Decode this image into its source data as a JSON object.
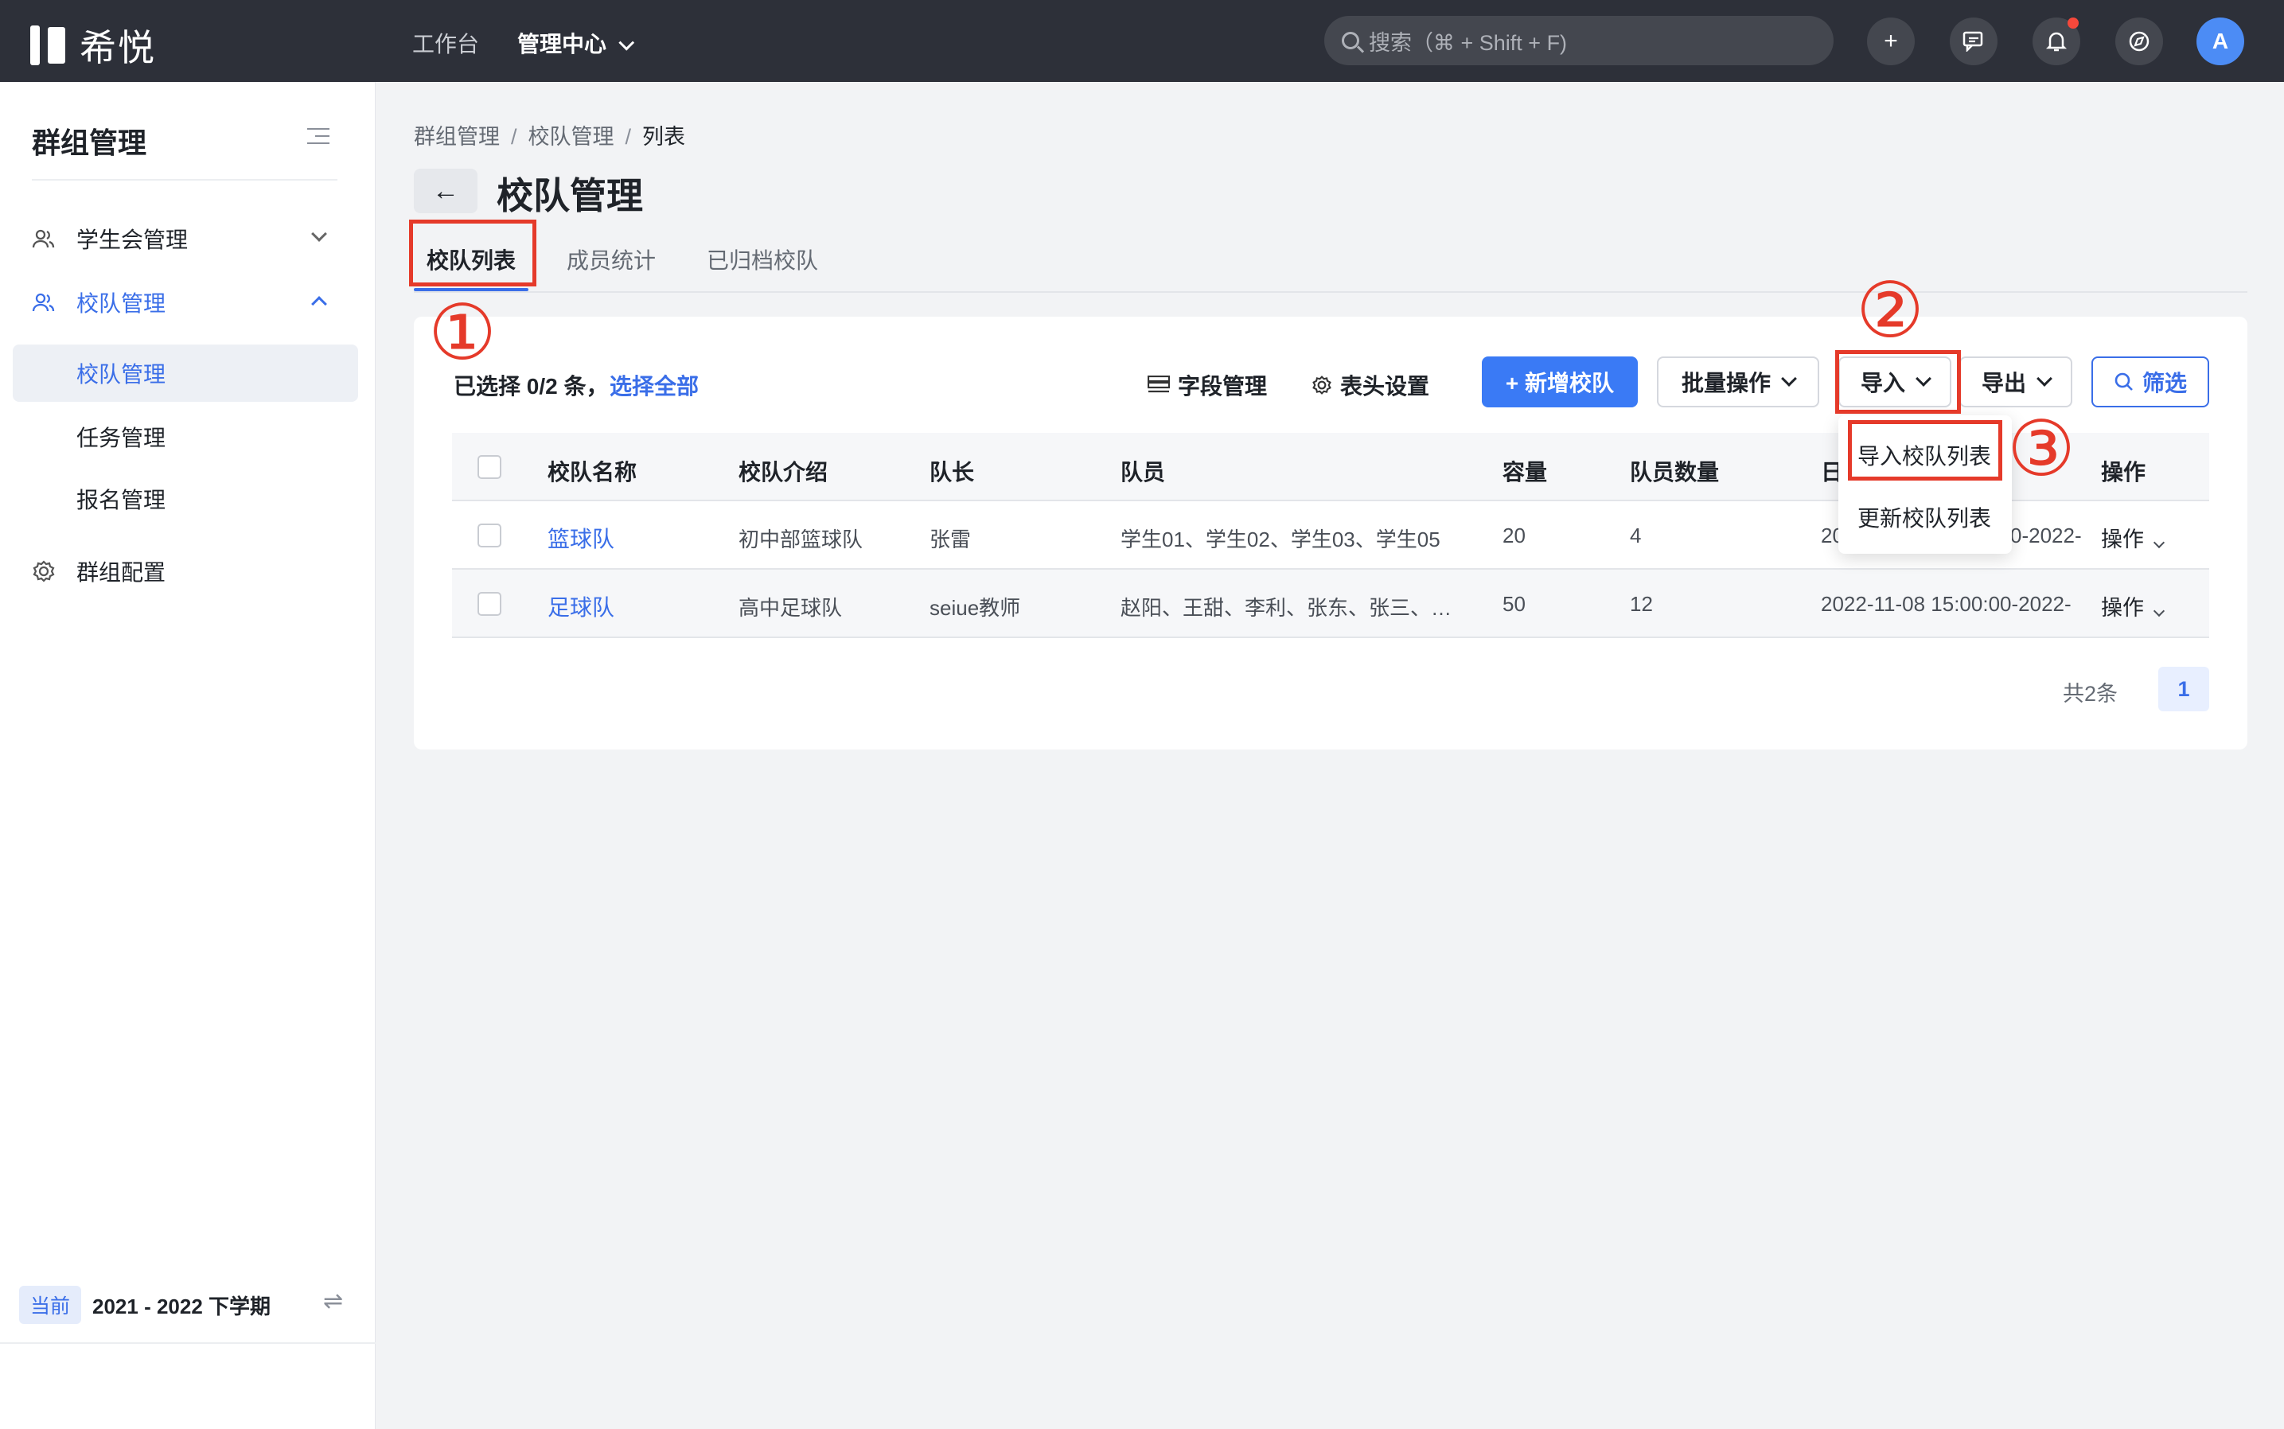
{
  "topbar": {
    "brand": "希悦",
    "nav": [
      "工作台",
      "管理中心"
    ],
    "search_placeholder": "搜索（⌘ + Shift + F)",
    "plus_icon": "+",
    "avatar": "A"
  },
  "sidebar": {
    "title": "群组管理",
    "items": [
      {
        "label": "学生会管理"
      },
      {
        "label": "校队管理"
      },
      {
        "label": "群组配置"
      }
    ],
    "subitems": [
      {
        "label": "校队管理"
      },
      {
        "label": "任务管理"
      },
      {
        "label": "报名管理"
      }
    ],
    "semester_badge": "当前",
    "semester": "2021 - 2022 下学期"
  },
  "breadcrumb": [
    "群组管理",
    "校队管理",
    "列表"
  ],
  "page_title": "校队管理",
  "tabs": [
    "校队列表",
    "成员统计",
    "已归档校队"
  ],
  "toolbar": {
    "selected": "已选择 0/2 条，",
    "select_all": "选择全部",
    "field_mgmt": "字段管理",
    "header_settings": "表头设置",
    "add_team": "+ 新增校队",
    "batch": "批量操作",
    "import": "导入",
    "export": "导出",
    "filter": "筛选"
  },
  "table": {
    "columns": [
      "校队名称",
      "校队介绍",
      "队长",
      "队员",
      "容量",
      "队员数量",
      "日",
      "操作"
    ],
    "rows": [
      {
        "name": "篮球队",
        "intro": "初中部篮球队",
        "captain": "张雷",
        "members": "学生01、学生02、学生03、学生05",
        "capacity": "20",
        "count": "4",
        "date": "20",
        "date_tail": "0-2022-",
        "op": "操作"
      },
      {
        "name": "足球队",
        "intro": "高中足球队",
        "captain": "seiue教师",
        "members": "赵阳、王甜、李利、张东、张三、…",
        "capacity": "50",
        "count": "12",
        "date": "2022-11-08 15:00:00-2022-",
        "op": "操作"
      }
    ]
  },
  "pagination": {
    "total": "共2条",
    "page": "1"
  },
  "dropdown": [
    "导入校队列表",
    "更新校队列表"
  ],
  "annotations": [
    "①",
    "②",
    "③"
  ],
  "colors": {
    "accent": "#3a6ee8",
    "primary_button": "#3a7af5",
    "annotation": "#e53a2a",
    "topbar": "#2d3039"
  }
}
